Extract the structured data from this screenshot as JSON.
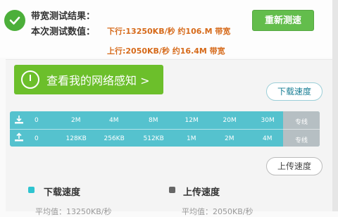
{
  "header": {
    "bandwidth_label": "带宽测试结果：",
    "current_label": "本次测试数值：",
    "download_result": "下行:13250KB/秒 约106.M 带宽",
    "upload_result": "上行:2050KB/秒 约16.4M 带宽",
    "retest_label": "重新测速"
  },
  "know_button": {
    "label": "查看我的网络感知 >"
  },
  "bubbles": {
    "download": "下载速度",
    "upload": "上传速度"
  },
  "scale": {
    "top_ticks": [
      "0",
      "2M",
      "4M",
      "8M",
      "12M",
      "20M",
      "30M",
      "专线"
    ],
    "bottom_ticks": [
      "0",
      "128KB",
      "256KB",
      "512KB",
      "1M",
      "2M",
      "4M",
      "专线"
    ]
  },
  "legend": {
    "download": {
      "title": "下载速度",
      "avg": "平均值：13250KB/秒"
    },
    "upload": {
      "title": "上传速度",
      "avg": "平均值：2050KB/秒"
    }
  },
  "colors": {
    "accent_green": "#63bd4c",
    "scale_teal": "#55c2ce",
    "result_orange": "#d66a1a"
  },
  "icons": [
    "check-icon",
    "clock-icon",
    "download-icon",
    "upload-icon"
  ]
}
